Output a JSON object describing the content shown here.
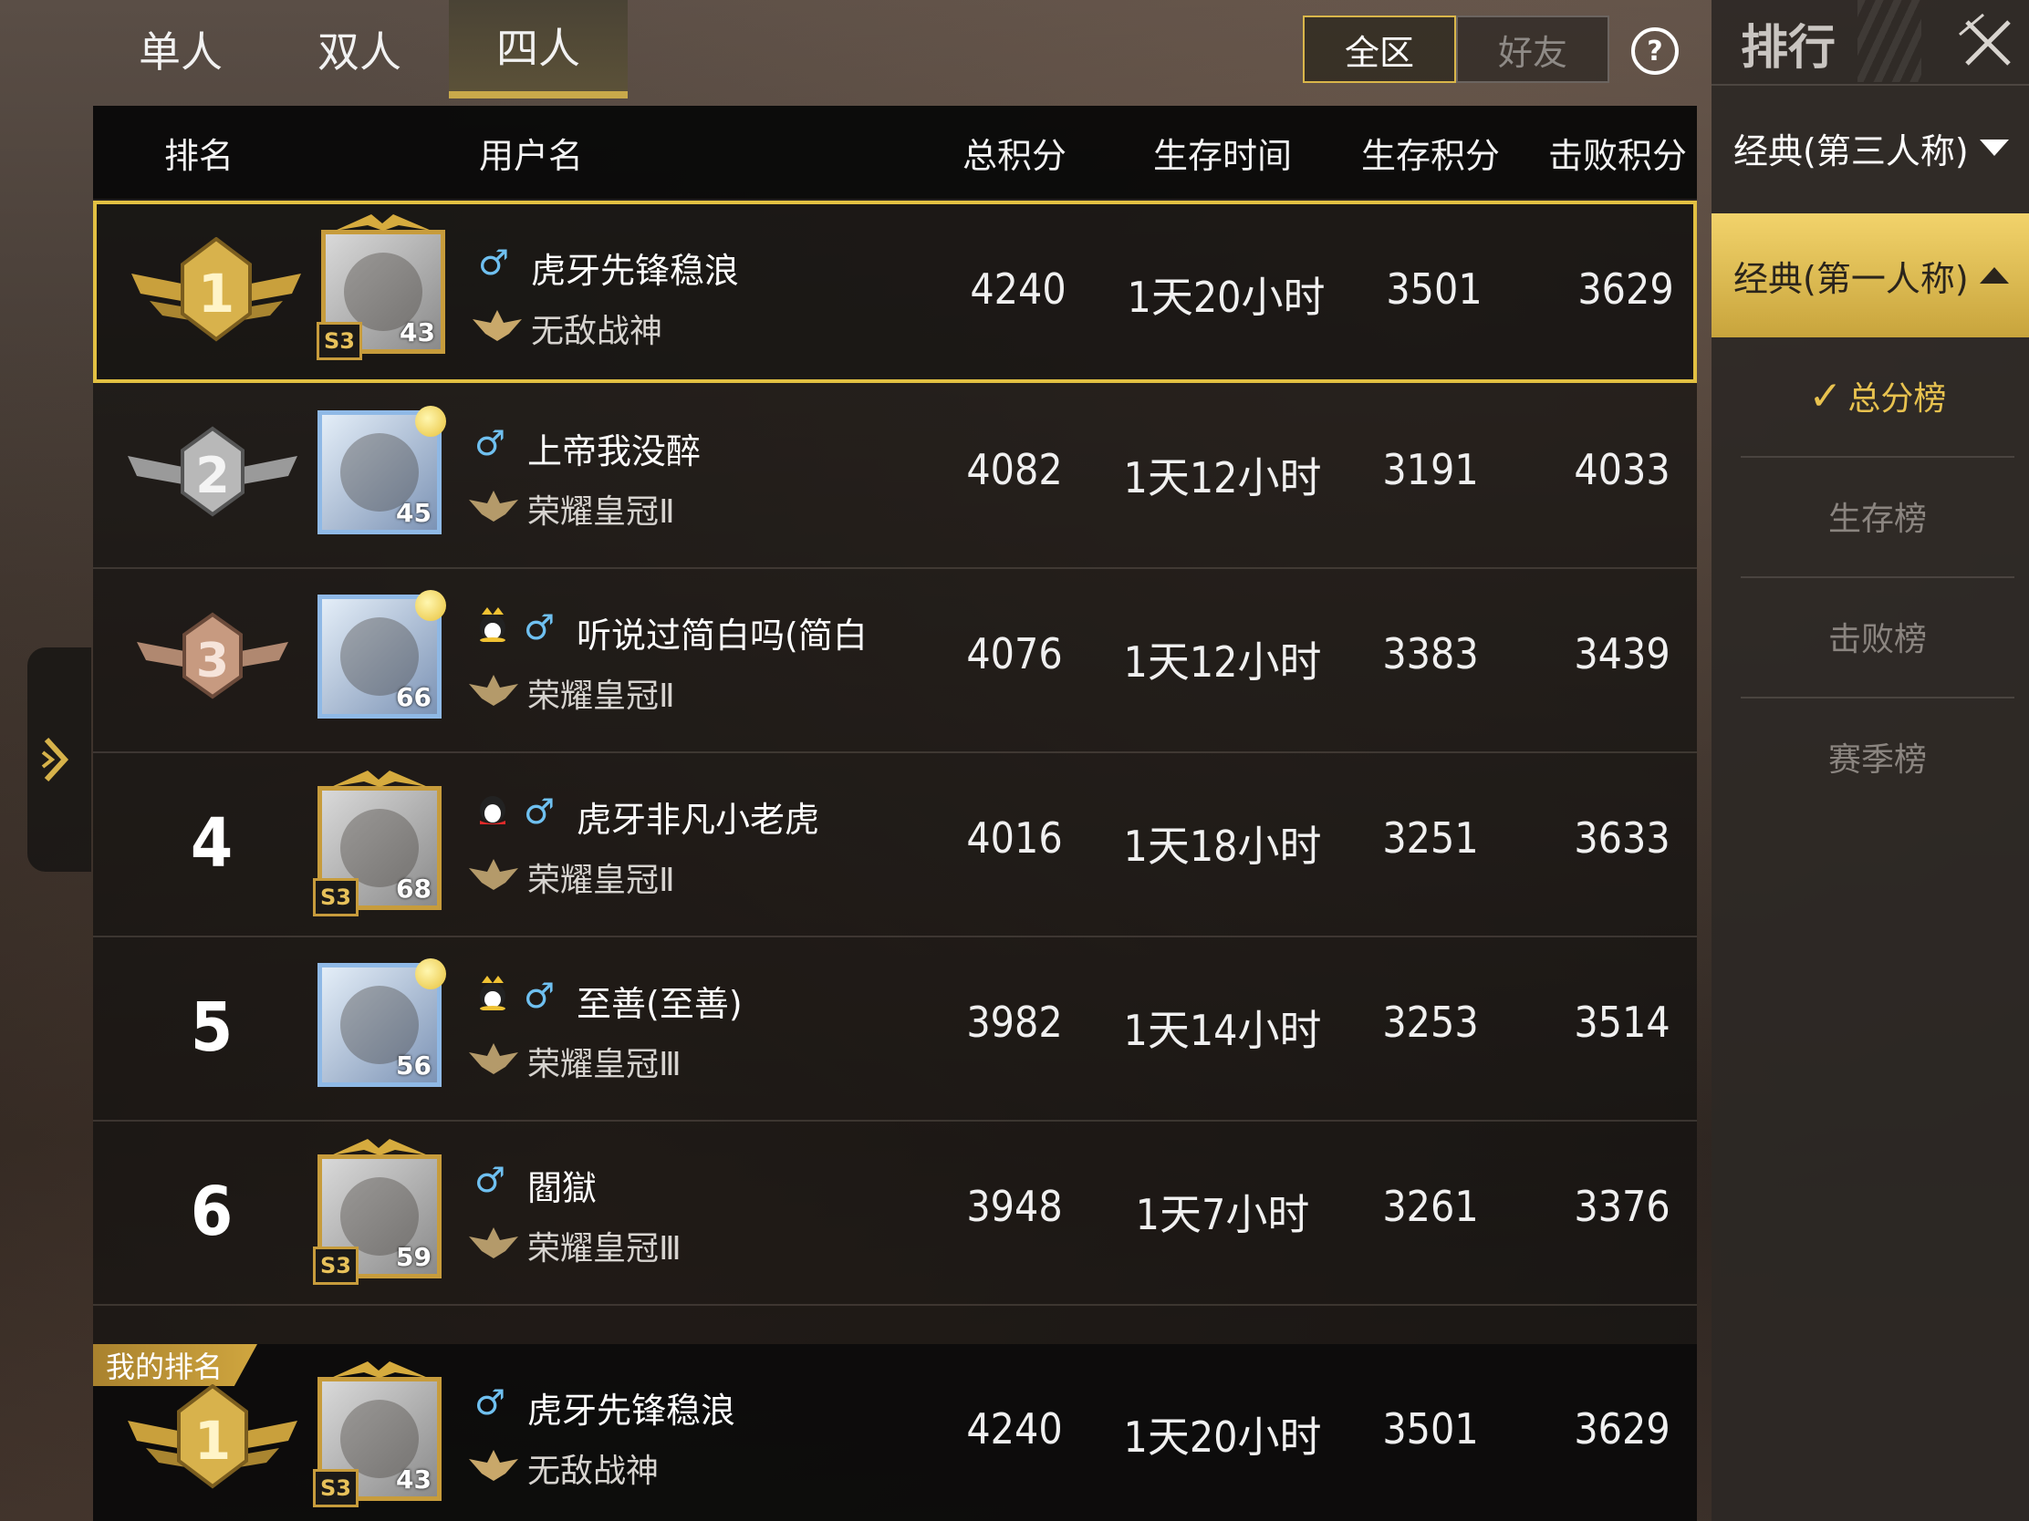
{
  "mode_tabs": [
    {
      "label": "单人",
      "active": false
    },
    {
      "label": "双人",
      "active": false
    },
    {
      "label": "四人",
      "active": true
    }
  ],
  "scope": {
    "all_label": "全区",
    "friends_label": "好友",
    "selected": "全区"
  },
  "help_glyph": "?",
  "columns": {
    "rank": "排名",
    "username": "用户名",
    "total": "总积分",
    "survival_time": "生存时间",
    "survival_score": "生存积分",
    "kill_score": "击败积分"
  },
  "rows": [
    {
      "rank": "1",
      "name": "虎牙先锋稳浪",
      "tier": "无敌战神",
      "level": "43",
      "season": "S3",
      "total": "4240",
      "time": "1天20小时",
      "survival": "3501",
      "kills": "3629",
      "emblem": ""
    },
    {
      "rank": "2",
      "name": "上帝我没醉",
      "tier": "荣耀皇冠Ⅱ",
      "level": "45",
      "season": "",
      "total": "4082",
      "time": "1天12小时",
      "survival": "3191",
      "kills": "4033",
      "emblem": ""
    },
    {
      "rank": "3",
      "name": "听说过简白吗(简白)",
      "tier": "荣耀皇冠Ⅱ",
      "level": "66",
      "season": "",
      "total": "4076",
      "time": "1天12小时",
      "survival": "3383",
      "kills": "3439",
      "emblem": "penguin-crown-icon"
    },
    {
      "rank": "4",
      "name": "虎牙非凡小老虎",
      "tier": "荣耀皇冠Ⅱ",
      "level": "68",
      "season": "S3",
      "total": "4016",
      "time": "1天18小时",
      "survival": "3251",
      "kills": "3633",
      "emblem": "penguin-icon"
    },
    {
      "rank": "5",
      "name": "至善(至善)",
      "tier": "荣耀皇冠Ⅲ",
      "level": "56",
      "season": "",
      "total": "3982",
      "time": "1天14小时",
      "survival": "3253",
      "kills": "3514",
      "emblem": "penguin-crown-icon"
    },
    {
      "rank": "6",
      "name": "閻獄",
      "tier": "荣耀皇冠Ⅲ",
      "level": "59",
      "season": "S3",
      "total": "3948",
      "time": "1天7小时",
      "survival": "3261",
      "kills": "3376",
      "emblem": ""
    }
  ],
  "my_rank": {
    "tag": "我的排名",
    "rank": "1",
    "name": "虎牙先锋稳浪",
    "tier": "无敌战神",
    "level": "43",
    "season": "S3",
    "total": "4240",
    "time": "1天20小时",
    "survival": "3501",
    "kills": "3629"
  },
  "side_panel": {
    "title": "排行",
    "modes": [
      {
        "label": "经典(第三人称)",
        "active": false
      },
      {
        "label": "经典(第一人称)",
        "active": true
      }
    ],
    "boards": [
      {
        "label": "总分榜",
        "active": true
      },
      {
        "label": "生存榜",
        "active": false
      },
      {
        "label": "击败榜",
        "active": false
      },
      {
        "label": "赛季榜",
        "active": false
      }
    ]
  },
  "colors": {
    "accent_gold": "#e2c042",
    "male_icon": "#6fc0f0"
  }
}
